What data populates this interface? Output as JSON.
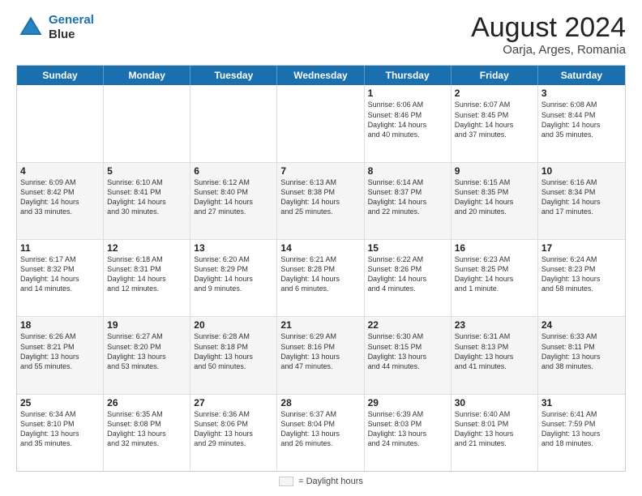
{
  "logo": {
    "line1": "General",
    "line2": "Blue"
  },
  "title": "August 2024",
  "subtitle": "Oarja, Arges, Romania",
  "days_header": [
    "Sunday",
    "Monday",
    "Tuesday",
    "Wednesday",
    "Thursday",
    "Friday",
    "Saturday"
  ],
  "weeks": [
    [
      {
        "day": "",
        "info": ""
      },
      {
        "day": "",
        "info": ""
      },
      {
        "day": "",
        "info": ""
      },
      {
        "day": "",
        "info": ""
      },
      {
        "day": "1",
        "info": "Sunrise: 6:06 AM\nSunset: 8:46 PM\nDaylight: 14 hours\nand 40 minutes."
      },
      {
        "day": "2",
        "info": "Sunrise: 6:07 AM\nSunset: 8:45 PM\nDaylight: 14 hours\nand 37 minutes."
      },
      {
        "day": "3",
        "info": "Sunrise: 6:08 AM\nSunset: 8:44 PM\nDaylight: 14 hours\nand 35 minutes."
      }
    ],
    [
      {
        "day": "4",
        "info": "Sunrise: 6:09 AM\nSunset: 8:42 PM\nDaylight: 14 hours\nand 33 minutes."
      },
      {
        "day": "5",
        "info": "Sunrise: 6:10 AM\nSunset: 8:41 PM\nDaylight: 14 hours\nand 30 minutes."
      },
      {
        "day": "6",
        "info": "Sunrise: 6:12 AM\nSunset: 8:40 PM\nDaylight: 14 hours\nand 27 minutes."
      },
      {
        "day": "7",
        "info": "Sunrise: 6:13 AM\nSunset: 8:38 PM\nDaylight: 14 hours\nand 25 minutes."
      },
      {
        "day": "8",
        "info": "Sunrise: 6:14 AM\nSunset: 8:37 PM\nDaylight: 14 hours\nand 22 minutes."
      },
      {
        "day": "9",
        "info": "Sunrise: 6:15 AM\nSunset: 8:35 PM\nDaylight: 14 hours\nand 20 minutes."
      },
      {
        "day": "10",
        "info": "Sunrise: 6:16 AM\nSunset: 8:34 PM\nDaylight: 14 hours\nand 17 minutes."
      }
    ],
    [
      {
        "day": "11",
        "info": "Sunrise: 6:17 AM\nSunset: 8:32 PM\nDaylight: 14 hours\nand 14 minutes."
      },
      {
        "day": "12",
        "info": "Sunrise: 6:18 AM\nSunset: 8:31 PM\nDaylight: 14 hours\nand 12 minutes."
      },
      {
        "day": "13",
        "info": "Sunrise: 6:20 AM\nSunset: 8:29 PM\nDaylight: 14 hours\nand 9 minutes."
      },
      {
        "day": "14",
        "info": "Sunrise: 6:21 AM\nSunset: 8:28 PM\nDaylight: 14 hours\nand 6 minutes."
      },
      {
        "day": "15",
        "info": "Sunrise: 6:22 AM\nSunset: 8:26 PM\nDaylight: 14 hours\nand 4 minutes."
      },
      {
        "day": "16",
        "info": "Sunrise: 6:23 AM\nSunset: 8:25 PM\nDaylight: 14 hours\nand 1 minute."
      },
      {
        "day": "17",
        "info": "Sunrise: 6:24 AM\nSunset: 8:23 PM\nDaylight: 13 hours\nand 58 minutes."
      }
    ],
    [
      {
        "day": "18",
        "info": "Sunrise: 6:26 AM\nSunset: 8:21 PM\nDaylight: 13 hours\nand 55 minutes."
      },
      {
        "day": "19",
        "info": "Sunrise: 6:27 AM\nSunset: 8:20 PM\nDaylight: 13 hours\nand 53 minutes."
      },
      {
        "day": "20",
        "info": "Sunrise: 6:28 AM\nSunset: 8:18 PM\nDaylight: 13 hours\nand 50 minutes."
      },
      {
        "day": "21",
        "info": "Sunrise: 6:29 AM\nSunset: 8:16 PM\nDaylight: 13 hours\nand 47 minutes."
      },
      {
        "day": "22",
        "info": "Sunrise: 6:30 AM\nSunset: 8:15 PM\nDaylight: 13 hours\nand 44 minutes."
      },
      {
        "day": "23",
        "info": "Sunrise: 6:31 AM\nSunset: 8:13 PM\nDaylight: 13 hours\nand 41 minutes."
      },
      {
        "day": "24",
        "info": "Sunrise: 6:33 AM\nSunset: 8:11 PM\nDaylight: 13 hours\nand 38 minutes."
      }
    ],
    [
      {
        "day": "25",
        "info": "Sunrise: 6:34 AM\nSunset: 8:10 PM\nDaylight: 13 hours\nand 35 minutes."
      },
      {
        "day": "26",
        "info": "Sunrise: 6:35 AM\nSunset: 8:08 PM\nDaylight: 13 hours\nand 32 minutes."
      },
      {
        "day": "27",
        "info": "Sunrise: 6:36 AM\nSunset: 8:06 PM\nDaylight: 13 hours\nand 29 minutes."
      },
      {
        "day": "28",
        "info": "Sunrise: 6:37 AM\nSunset: 8:04 PM\nDaylight: 13 hours\nand 26 minutes."
      },
      {
        "day": "29",
        "info": "Sunrise: 6:39 AM\nSunset: 8:03 PM\nDaylight: 13 hours\nand 24 minutes."
      },
      {
        "day": "30",
        "info": "Sunrise: 6:40 AM\nSunset: 8:01 PM\nDaylight: 13 hours\nand 21 minutes."
      },
      {
        "day": "31",
        "info": "Sunrise: 6:41 AM\nSunset: 7:59 PM\nDaylight: 13 hours\nand 18 minutes."
      }
    ]
  ],
  "legend": {
    "box_label": "= Daylight hours"
  }
}
